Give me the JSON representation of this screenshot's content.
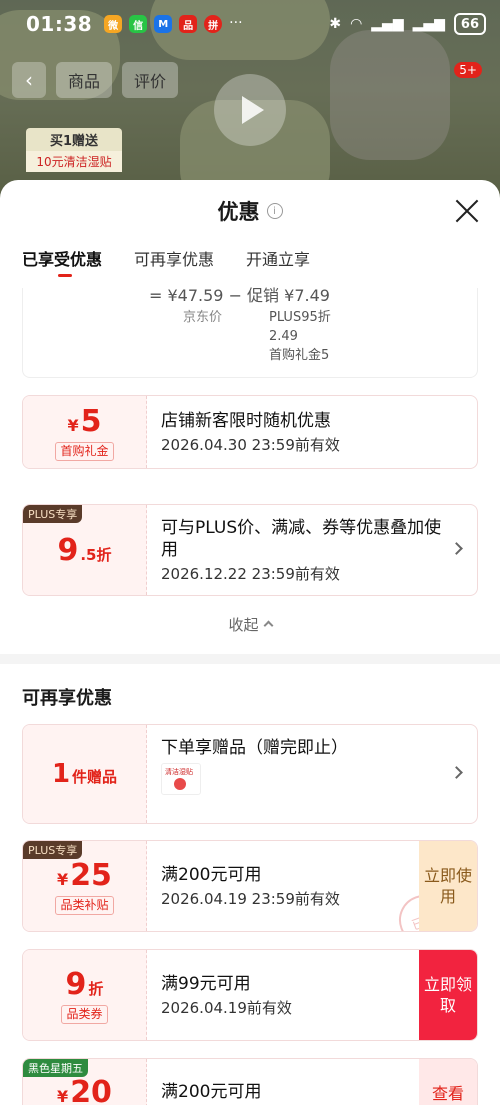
{
  "status_bar": {
    "time": "01:38",
    "battery": "66"
  },
  "background": {
    "tabs": [
      "商品",
      "评价"
    ],
    "promo_title": "买1赠送",
    "promo_sub": "10元清洁湿贴",
    "badge": "5+"
  },
  "sheet": {
    "title": "优惠",
    "tabs": [
      {
        "label": "已享受优惠",
        "active": true
      },
      {
        "label": "可再享优惠",
        "active": false
      },
      {
        "label": "开通立享",
        "active": false
      }
    ],
    "price_card": {
      "top_line": "= ¥47.59  −  促销 ¥7.49",
      "jd_price_label": "京东价",
      "details": [
        "PLUS95折",
        "2.49",
        "首购礼金5"
      ]
    },
    "enjoyed": [
      {
        "amount": "5",
        "currency": "¥",
        "unit": "",
        "badge": "首购礼金",
        "title": "店铺新客限时随机优惠",
        "date": "2026.04.30 23:59前有效",
        "tag": ""
      },
      {
        "amount": "9",
        "currency": "",
        "unit": ".5折",
        "badge": "",
        "title": "可与PLUS价、满减、券等优惠叠加使用",
        "date": "2026.12.22 23:59前有效",
        "tag": "PLUS专享"
      }
    ],
    "collapse_label": "收起",
    "more_title": "可再享优惠",
    "more": [
      {
        "amount": "1",
        "unit": "件赠品",
        "title": "下单享赠品（赠完即止）",
        "gift_label": "清洁湿贴"
      },
      {
        "tag": "PLUS专享",
        "currency": "¥",
        "amount": "25",
        "badge": "品类补贴",
        "title": "满200元可用",
        "date": "2026.04.19 23:59前有效",
        "action": "立即使用",
        "stamp": "已领"
      },
      {
        "amount": "9",
        "unit": "折",
        "badge": "品类券",
        "title": "满99元可用",
        "date": "2026.04.19前有效",
        "action": "立即领取"
      },
      {
        "tag": "黑色星期五",
        "currency": "¥",
        "amount": "20",
        "title": "满200元可用",
        "action": "查看"
      }
    ]
  }
}
